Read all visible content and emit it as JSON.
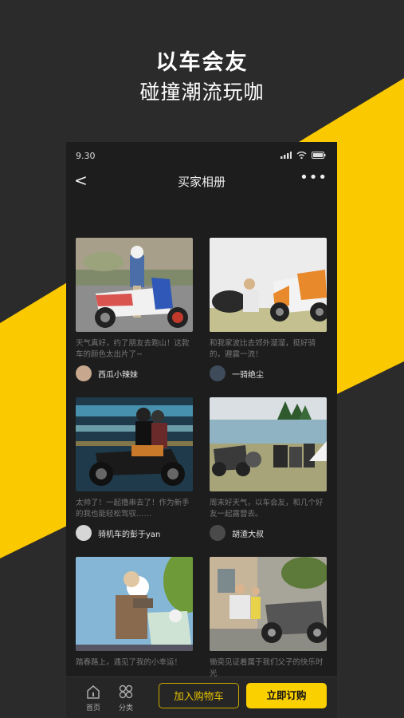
{
  "promo": {
    "headline": "以车会友",
    "subheadline": "碰撞潮流玩咖"
  },
  "status": {
    "time": "9.30"
  },
  "nav": {
    "title": "买家相册",
    "back": "<",
    "more": "•••"
  },
  "posts": [
    {
      "caption": "天气真好，约了朋友去跑山！这款车的颜色太出片了~",
      "user": "西瓜小辣妹"
    },
    {
      "caption": "和我家波比去郊外溜溜，挺好骑的，避震一流！",
      "user": "一骑绝尘"
    },
    {
      "caption": "太帅了！一起撸串去了！作为新手的我也能轻松驾驭……",
      "user": "骑机车的彭于yan"
    },
    {
      "caption": "周末好天气，以车会友，和几个好友一起露营去。",
      "user": "胡渣大叔"
    },
    {
      "caption": "踏春路上，遇见了我的小幸运！",
      "user": ""
    },
    {
      "caption": "锄奕见证着属于我们父子的快乐时光",
      "user": ""
    }
  ],
  "bottom_bar": {
    "home_label": "首页",
    "category_label": "分类",
    "cart_label": "加入购物车",
    "buy_label": "立即订购"
  },
  "colors": {
    "accent": "#fad000",
    "background": "#2b2b2b",
    "phone_bg": "#1d1d1d"
  }
}
